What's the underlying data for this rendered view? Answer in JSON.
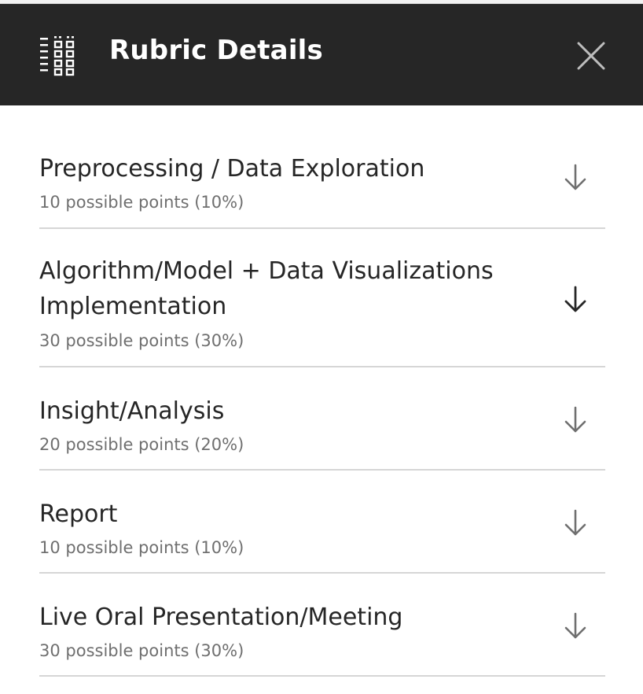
{
  "header": {
    "title": "Rubric Details",
    "icon": "rubric-grid-icon",
    "close_icon": "close-icon",
    "background": "#262626"
  },
  "criteria": [
    {
      "title": "Preprocessing / Data Exploration",
      "points": "10 possible points (10%)"
    },
    {
      "title": "Algorithm/Model + Data Visualizations Implementation",
      "points": "30 possible points (30%)"
    },
    {
      "title": "Insight/Analysis",
      "points": "20 possible points (20%)"
    },
    {
      "title": "Report",
      "points": "10 possible points (10%)"
    },
    {
      "title": "Live Oral Presentation/Meeting",
      "points": "30 possible points (30%)"
    }
  ],
  "expand_icon": "arrow-down-icon"
}
